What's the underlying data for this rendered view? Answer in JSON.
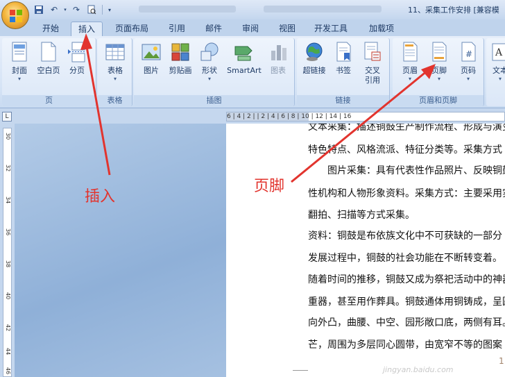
{
  "titlebar": {
    "title": "11、采集工作安排 [兼容模"
  },
  "tabs": [
    {
      "label": "开始"
    },
    {
      "label": "插入"
    },
    {
      "label": "页面布局"
    },
    {
      "label": "引用"
    },
    {
      "label": "邮件"
    },
    {
      "label": "审阅"
    },
    {
      "label": "视图"
    },
    {
      "label": "开发工具"
    },
    {
      "label": "加载项"
    }
  ],
  "groups": {
    "pages": {
      "label": "页",
      "cover": "封面",
      "blank": "空白页",
      "break": "分页"
    },
    "tables": {
      "label": "表格",
      "table": "表格"
    },
    "illustrations": {
      "label": "插图",
      "picture": "图片",
      "clipart": "剪贴画",
      "shapes": "形状",
      "smartart": "SmartArt",
      "chart": "图表"
    },
    "links": {
      "label": "链接",
      "hyperlink": "超链接",
      "bookmark": "书签",
      "crossref_1": "交叉",
      "crossref_2": "引用"
    },
    "header_footer": {
      "label": "页眉和页脚",
      "header": "页眉",
      "footer": "页脚",
      "page_number": "页码"
    },
    "text": {
      "textbox": "文本"
    }
  },
  "ruler": {
    "corner": "L",
    "marks": "6  |  4  |  2  |     |  2  |  4  |  6  |  8  |  10  |  12  |  14  |  16",
    "vertical": [
      "30",
      "32",
      "34",
      "36",
      "38",
      "40",
      "42",
      "44",
      "46"
    ]
  },
  "document": {
    "lines": [
      "文本采集：描述铜鼓生产制作流程、形成与演变",
      "特色特点、风格流派、特征分类等。采集方式",
      "　　图片采集：具有代表性作品照片、反映铜鼓",
      "性机构和人物形象资料。采集方式：主要采用实",
      "翻拍、扫描等方式采集。",
      "资料：铜鼓是布依族文化中不可获缺的一部分",
      "发展过程中，铜鼓的社会功能在不断转变着。",
      "随着时间的推移，铜鼓又成为祭祀活动中的神器",
      "重器，甚至用作葬具。铜鼓通体用铜铸成，呈圆",
      "向外凸，曲腰、中空、园形敞口底，两侧有耳。",
      "芒，周围为多层同心圆带，由宽窄不等的图案"
    ],
    "page_number": "1"
  },
  "annotations": {
    "insert_label": "插入",
    "footer_label": "页脚"
  },
  "watermark": "jingyan.baidu.com",
  "colors": {
    "annotation": "#e2342e",
    "ribbon_bg": "#dbe7f7",
    "workspace": "#9db9dc"
  }
}
